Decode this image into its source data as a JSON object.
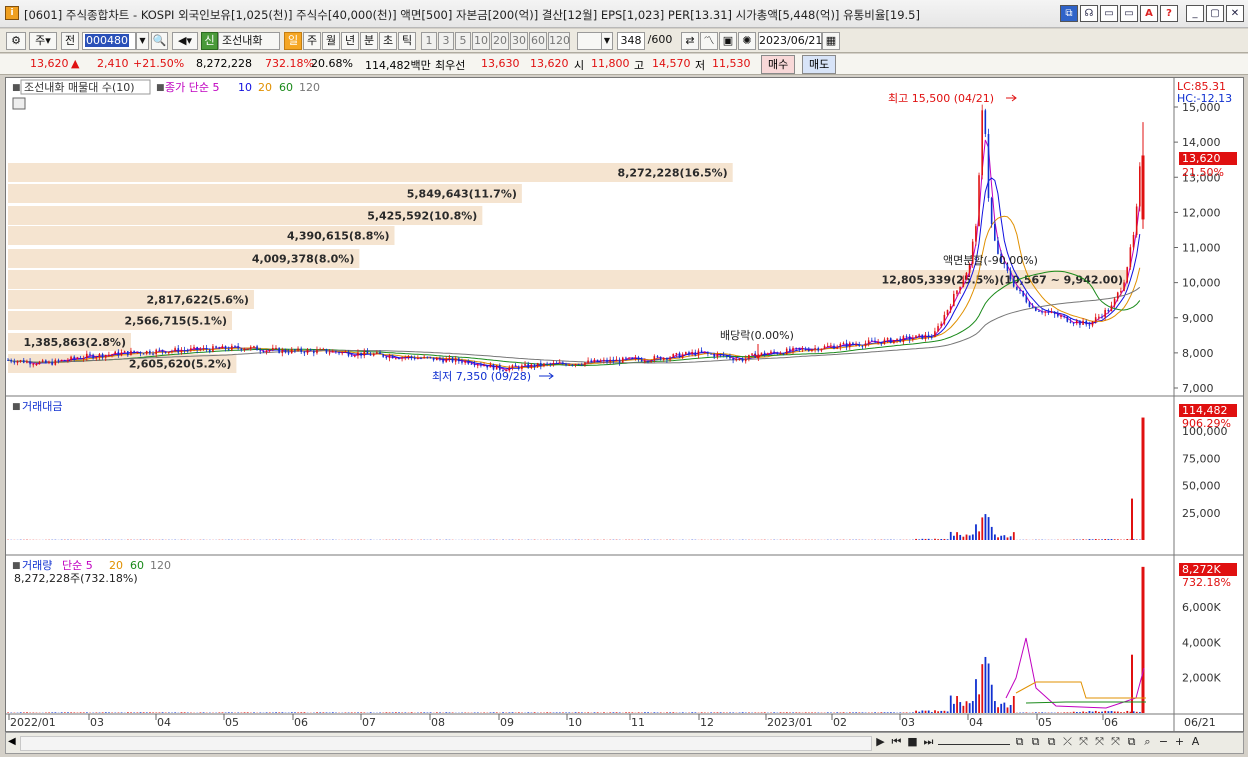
{
  "window": {
    "title": "[0601] 주식종합차트 - KOSPI 외국인보유[1,025(천)] 주식수[40,000(천)] 액면[500] 자본금[200(억)] 결산[12월] EPS[1,023] PER[13.31] 시가총액[5,448(억)] 유통비율[19.5]",
    "buttons": [
      "⧉",
      "☊",
      "▭",
      "▭",
      "A",
      "?",
      "_",
      "▢",
      "✕"
    ]
  },
  "toolbar": {
    "market": "주",
    "prev": "전",
    "code": "000480",
    "stock_name": "조선내화",
    "badge": "신",
    "periods": [
      "일",
      "주",
      "월",
      "년",
      "분",
      "초",
      "틱"
    ],
    "minutes": [
      "1",
      "3",
      "5",
      "10",
      "20",
      "30",
      "60",
      "120"
    ],
    "count": "348",
    "count_total": "/600",
    "date": "2023/06/21"
  },
  "infobar": {
    "price": "13,620",
    "arrow": "▲",
    "change": "2,410",
    "change_pct": "+21.50%",
    "volume": "8,272,228",
    "vol_ratio": "732.18%",
    "turnover": "20.68%",
    "amount": "114,482백만",
    "best_label": "최우선",
    "ask": "13,630",
    "bid": "13,620",
    "open_label": "시",
    "open": "11,800",
    "high_label": "고",
    "high": "14,570",
    "low_label": "저",
    "low": "11,530",
    "buy": "매수",
    "sell": "매도"
  },
  "price_panel": {
    "legend_vp": "조선내화 매물대 수(10)",
    "legend_ma": "종가 단순 5",
    "ma_periods": [
      "10",
      "20",
      "60",
      "120"
    ],
    "ma_colors": [
      "#c000c0",
      "#1010e0",
      "#e09000",
      "#1a8a1a",
      "#777777"
    ],
    "lc": "LC:85.31",
    "hc": "HC:-12.13",
    "cur_price": "13,620",
    "cur_pct": "21.50%",
    "y_ticks": [
      "15,000",
      "14,000",
      "13,000",
      "12,000",
      "11,000",
      "10,000",
      "9,000",
      "8,000",
      "7,000"
    ],
    "annotations": {
      "high": "최고 15,500 (04/21)",
      "low": "최저 7,350 (09/28)",
      "dividend": "배당락(0.00%)",
      "split": "액면분할(-90.00%)"
    },
    "volume_profile": [
      {
        "label": "8,272,228(16.5%)",
        "pct": 16.5
      },
      {
        "label": "5,849,643(11.7%)",
        "pct": 11.7
      },
      {
        "label": "5,425,592(10.8%)",
        "pct": 10.8
      },
      {
        "label": "4,390,615(8.8%)",
        "pct": 8.8
      },
      {
        "label": "4,009,378(8.0%)",
        "pct": 8.0
      },
      {
        "label": "12,805,339(25.5%)(10,567 ~ 9,942.00)",
        "pct": 25.5
      },
      {
        "label": "2,817,622(5.6%)",
        "pct": 5.6
      },
      {
        "label": "2,566,715(5.1%)",
        "pct": 5.1
      },
      {
        "label": "1,385,863(2.8%)",
        "pct": 2.8
      },
      {
        "label": "2,605,620(5.2%)",
        "pct": 5.2
      }
    ]
  },
  "amount_panel": {
    "title": "거래대금",
    "cur": "114,482",
    "cur_pct": "906.29%",
    "y_ticks": [
      "100,000",
      "75,000",
      "50,000",
      "25,000"
    ]
  },
  "volume_panel": {
    "title": "거래량",
    "ma_label": "단순 5",
    "ma_periods": [
      "20",
      "60",
      "120"
    ],
    "sub": "8,272,228주(732.18%)",
    "cur": "8,272K",
    "cur_pct": "732.18%",
    "y_ticks": [
      "6,000K",
      "4,000K",
      "2,000K"
    ]
  },
  "x_axis": [
    "2022/01",
    "03",
    "04",
    "05",
    "06",
    "07",
    "08",
    "09",
    "10",
    "11",
    "12",
    "2023/01",
    "02",
    "03",
    "04",
    "05",
    "06"
  ],
  "x_axis_right": "06/21",
  "chart_data": {
    "type": "candlestick",
    "x_range": [
      "2022/01",
      "2023/06/21"
    ],
    "price_ylim": [
      7000,
      15500
    ],
    "max": {
      "value": 15500,
      "date": "04/21"
    },
    "min": {
      "value": 7350,
      "date": "09/28"
    },
    "price_trend": [
      [
        "2022/01",
        7800
      ],
      [
        "03",
        7900
      ],
      [
        "04",
        8000
      ],
      [
        "05",
        8150
      ],
      [
        "06",
        8100
      ],
      [
        "07",
        8050
      ],
      [
        "08",
        7950
      ],
      [
        "09",
        7700
      ],
      [
        "10",
        7650
      ],
      [
        "11",
        7750
      ],
      [
        "12",
        8000
      ],
      [
        "2023/01",
        7800
      ],
      [
        "02",
        8100
      ],
      [
        "03",
        8400
      ],
      [
        "04",
        9600
      ],
      [
        "04/21",
        15500
      ],
      [
        "05",
        9500
      ],
      [
        "06",
        8800
      ],
      [
        "06/21",
        13620
      ]
    ],
    "last": {
      "open": 11800,
      "high": 14570,
      "low": 11530,
      "close": 13620
    },
    "amount_ylim": [
      0,
      110000
    ],
    "volume_ylim": [
      0,
      8300
    ]
  }
}
